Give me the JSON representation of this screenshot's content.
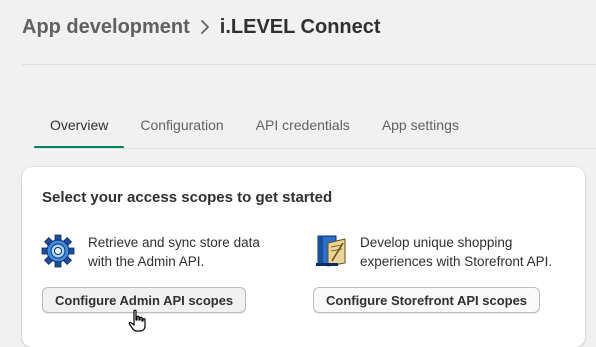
{
  "breadcrumb": {
    "parent": "App development",
    "current": "i.LEVEL Connect"
  },
  "tabs": [
    {
      "label": "Overview",
      "active": true
    },
    {
      "label": "Configuration",
      "active": false
    },
    {
      "label": "API credentials",
      "active": false
    },
    {
      "label": "App settings",
      "active": false
    }
  ],
  "card": {
    "title": "Select your access scopes to get started",
    "admin": {
      "description": "Retrieve and sync store data with the Admin API.",
      "button_label": "Configure Admin API scopes",
      "icon": "gear-icon"
    },
    "storefront": {
      "description": "Develop unique shopping experiences with Storefront API.",
      "button_label": "Configure Storefront API scopes",
      "icon": "storefront-book-icon"
    }
  },
  "colors": {
    "active_tab_underline": "#008060",
    "background": "#f1f1f1",
    "card": "#ffffff"
  }
}
